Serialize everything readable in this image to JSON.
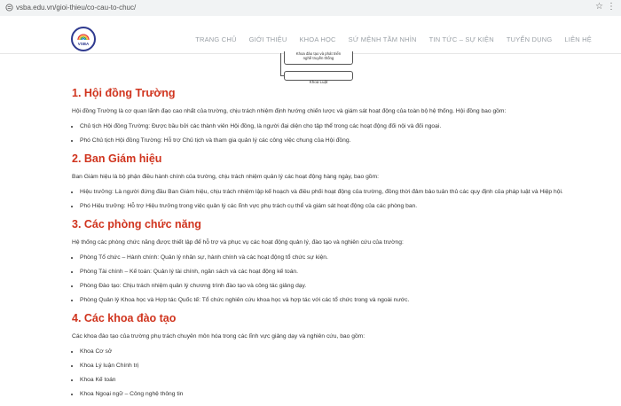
{
  "browser": {
    "url": "vsba.edu.vn/gioi-thieu/co-cau-to-chuc/",
    "star_icon": "star-icon",
    "menu_icon": "more-vertical-icon"
  },
  "header": {
    "logo_text": "VSBA",
    "nav": [
      "TRANG CHỦ",
      "GIỚI THIỆU",
      "KHOA HỌC",
      "SỨ MỆNH TẦM NHÌN",
      "TIN TỨC – SỰ KIỆN",
      "TUYỂN DỤNG",
      "LIÊN HỆ"
    ]
  },
  "diagram": {
    "box1_line1": "Khoa đào tạo và phát triển",
    "box1_line2": "nghề truyền thống",
    "box2": "Khoa Luật"
  },
  "sections": [
    {
      "title": "1. Hội đồng Trường",
      "intro": "Hội đồng Trường là cơ quan lãnh đạo cao nhất của trường, chịu trách nhiệm định hướng chiến lược và giám sát hoạt động của toàn bộ hệ thống. Hội đồng bao gồm:",
      "items": [
        "Chủ tịch Hội đồng Trường: Được bầu bởi các thành viên Hội đồng, là người đại diện cho tập thể trong các hoạt động đối nội và đối ngoại.",
        "Phó Chủ tịch Hội đồng Trường: Hỗ trợ Chủ tịch và tham gia quản lý các công việc chung của Hội đồng."
      ]
    },
    {
      "title": "2. Ban Giám hiệu",
      "intro": "Ban Giám hiệu là bộ phận điều hành chính của trường, chịu trách nhiệm quản lý các hoạt động hàng ngày, bao gồm:",
      "items": [
        "Hiệu trưởng: Là người đứng đầu Ban Giám hiệu, chịu trách nhiệm lập kế hoạch và điều phối hoạt động của trường, đồng thời đảm bảo tuân thủ các quy định của pháp luật và Hiệp hội.",
        "Phó Hiệu trưởng: Hỗ trợ Hiệu trưởng trong việc quản lý các lĩnh vực phụ trách cụ thể và giám sát hoạt động của các phòng ban."
      ]
    },
    {
      "title": "3. Các phòng chức năng",
      "intro": "Hệ thống các phòng chức năng được thiết lập để hỗ trợ và phục vụ các hoạt động quản lý, đào tạo và nghiên cứu của trường:",
      "items": [
        "Phòng Tổ chức – Hành chính: Quản lý nhân sự, hành chính và các hoạt động tổ chức sự kiện.",
        "Phòng Tài chính – Kế toán: Quản lý tài chính, ngân sách và các hoạt động kế toán.",
        "Phòng Đào tạo: Chịu trách nhiệm quản lý chương trình đào tạo và công tác giảng dạy.",
        "Phòng Quản lý Khoa học và Hợp tác Quốc tế: Tổ chức nghiên cứu khoa học và hợp tác với các tổ chức trong và ngoài nước."
      ]
    },
    {
      "title": "4. Các khoa đào tạo",
      "intro": "Các khoa đào tạo của trường phụ trách chuyên môn hóa trong các lĩnh vực giảng dạy và nghiên cứu, bao gồm:",
      "items": [
        "Khoa Cơ sở",
        "Khoa Lý luận Chính trị",
        "Khoa Kế toán",
        "Khoa Ngoại ngữ – Công nghệ thông tin"
      ]
    }
  ]
}
